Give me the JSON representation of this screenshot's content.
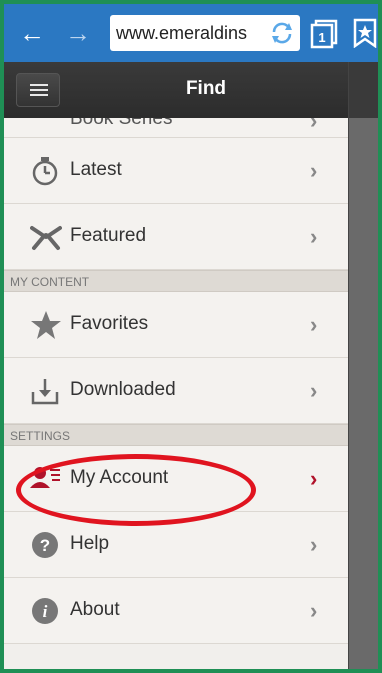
{
  "browser": {
    "url": "www.emeraldins",
    "back_icon": "back-arrow-icon",
    "forward_icon": "forward-arrow-icon",
    "reload_icon": "reload-icon",
    "tabs_count": "1",
    "bookmark_icon": "bookmark-star-icon"
  },
  "header": {
    "title": "Find",
    "menu_icon": "hamburger-menu-icon"
  },
  "menu": {
    "partial_item": "Book Series",
    "items_browse": [
      {
        "label": "Latest",
        "icon": "stopwatch-icon"
      },
      {
        "label": "Featured",
        "icon": "ribbon-icon"
      }
    ],
    "section_content": "MY CONTENT",
    "items_content": [
      {
        "label": "Favorites",
        "icon": "star-icon"
      },
      {
        "label": "Downloaded",
        "icon": "download-tray-icon"
      }
    ],
    "section_settings": "SETTINGS",
    "items_settings": [
      {
        "label": "My Account",
        "icon": "user-list-icon",
        "active": true
      },
      {
        "label": "Help",
        "icon": "question-circle-icon"
      },
      {
        "label": "About",
        "icon": "info-circle-icon"
      }
    ]
  },
  "colors": {
    "browser_bar": "#2b78c2",
    "outer_frame": "#1f8f55",
    "accent_red": "#b0122a",
    "highlight_ellipse": "#e0141f"
  }
}
